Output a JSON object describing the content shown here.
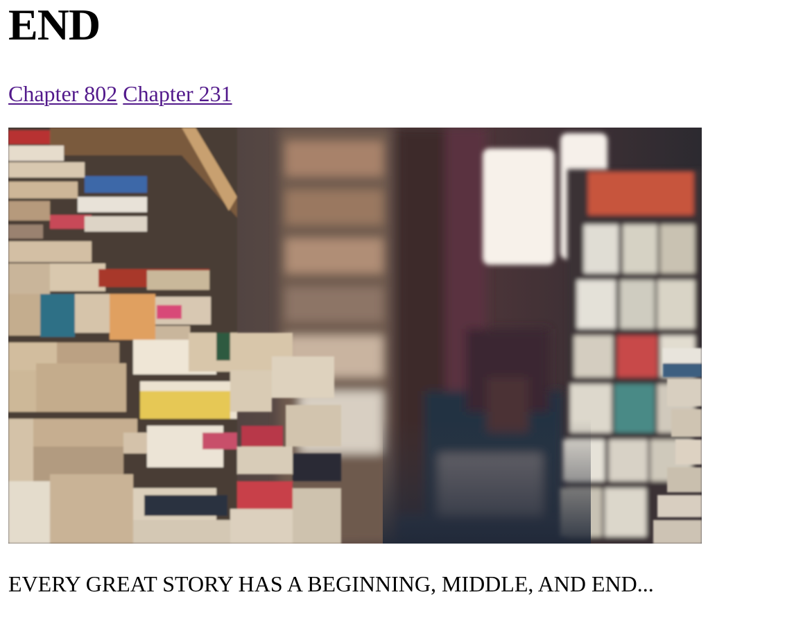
{
  "page": {
    "title": "END",
    "links": [
      {
        "label": "Chapter 802"
      },
      {
        "label": "Chapter 231"
      }
    ],
    "image": {
      "subject": "bookstore-shelves-photo"
    },
    "tagline": "EVERY GREAT STORY HAS A BEGINNING, MIDDLE, AND END..."
  },
  "colors": {
    "link": "#52198b",
    "text": "#000000",
    "background": "#ffffff"
  }
}
